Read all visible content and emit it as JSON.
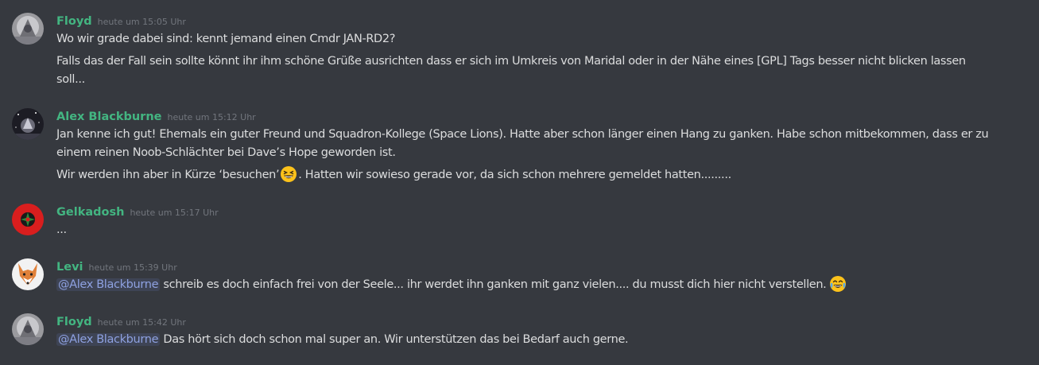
{
  "messages": [
    {
      "author": "Floyd",
      "timestamp": "heute um 15:05 Uhr",
      "lines": [
        "Wo wir grade dabei sind: kennt jemand einen Cmdr JAN-RD2?",
        "Falls das der Fall sein sollte könnt ihr ihm schöne Grüße ausrichten dass er sich im Umkreis von Maridal oder in der Nähe eines [GPL] Tags besser nicht blicken lassen",
        "soll..."
      ]
    },
    {
      "author": "Alex Blackburne",
      "timestamp": "heute um 15:12 Uhr",
      "lines": [
        "Jan kenne ich gut! Ehemals ein guter Freund und Squadron-Kollege (Space Lions). Hatte aber schon länger einen Hang zu ganken. Habe schon mitbekommen, dass er zu",
        "einem reinen Noob-Schlächter bei Dave’s Hope geworden ist."
      ],
      "line3_before_emoji": "Wir werden ihn aber in Kürze ‘besuchen’",
      "line3_after_emoji": ". Hatten wir sowieso gerade vor, da sich schon mehrere gemeldet hatten.........",
      "emoji": "grinning-squinting-face"
    },
    {
      "author": "Gelkadosh",
      "timestamp": "heute um 15:17 Uhr",
      "lines": [
        "..."
      ]
    },
    {
      "author": "Levi",
      "timestamp": "heute um 15:39 Uhr",
      "mention": "@Alex Blackburne",
      "text": " schreib es doch einfach frei von der Seele... ihr werdet ihn ganken mit ganz vielen.... du musst dich hier nicht verstellen.",
      "emoji": "face-with-tears-of-joy"
    },
    {
      "author": "Floyd",
      "timestamp": "heute um 15:42 Uhr",
      "mention": "@Alex Blackburne",
      "text": " Das hört sich doch schon mal super an. Wir unterstützen das bei Bedarf auch gerne."
    }
  ],
  "colors": {
    "background": "#36393f",
    "author": "#43b581",
    "text": "#dcddde",
    "timestamp": "#72767d",
    "mention_text": "#8ea1e1"
  }
}
